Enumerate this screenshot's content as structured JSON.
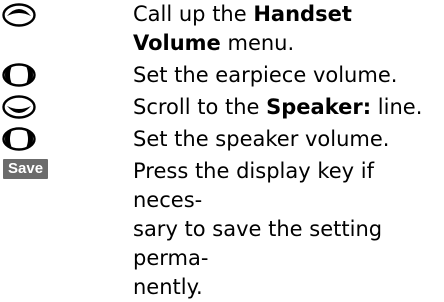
{
  "steps": [
    {
      "icon": "control-key-up-icon",
      "text_before": "Call up the ",
      "bold": "Handset Volume",
      "text_after": " menu."
    },
    {
      "icon": "control-key-left-right-icon",
      "text": "Set the earpiece volume."
    },
    {
      "icon": "control-key-down-icon",
      "text_before": "Scroll to the ",
      "bold": "Speaker:",
      "text_after": " line."
    },
    {
      "icon": "control-key-left-right-icon",
      "text": "Set the speaker volume."
    },
    {
      "key_label": "Save",
      "lines": [
        "Press the display key if neces-",
        "sary to save the setting perma-",
        "nently."
      ]
    }
  ],
  "colors": {
    "text": "#000000",
    "key_background": "#6b6b6b",
    "key_text": "#ffffff"
  }
}
